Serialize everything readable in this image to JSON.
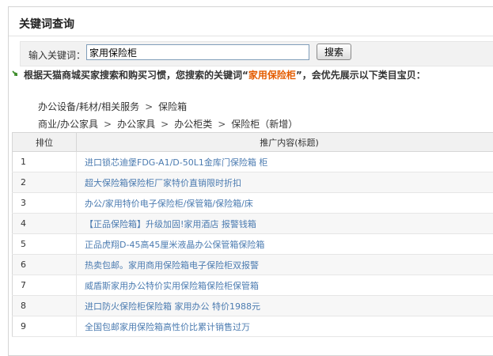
{
  "header": {
    "title": "关键词查询"
  },
  "search": {
    "label": "输入关键词：",
    "value": "家用保险柜",
    "button": "搜索"
  },
  "notice": {
    "prefix": "根据天猫商城买家搜索和购买习惯，您搜索的关键词“",
    "keyword": "家用保险柜",
    "suffix": "”，会优先展示以下类目宝贝："
  },
  "categories": [
    [
      "办公设备/耗材/相关服务",
      "保险箱"
    ],
    [
      "商业/办公家具",
      "办公家具",
      "办公柜类",
      "保险柜（新增）"
    ]
  ],
  "table": {
    "headers": [
      "排位",
      "推广内容(标题)"
    ],
    "rows": [
      {
        "rank": "1",
        "title": "进口锁芯迪堡FDG-A1/D-50L1金库门保险箱 柜"
      },
      {
        "rank": "2",
        "title": "超大保险箱保险柜厂家特价直销限时折扣"
      },
      {
        "rank": "3",
        "title": "办公/家用特价电子保险柜/保管箱/保险箱/床"
      },
      {
        "rank": "4",
        "title": "【正品保险箱】升级加固!家用酒店 报警钱箱"
      },
      {
        "rank": "5",
        "title": "正品虎翔D-45高45厘米液晶办公保管箱保险箱"
      },
      {
        "rank": "6",
        "title": "热卖包邮。家用商用保险箱电子保险柜双报警"
      },
      {
        "rank": "7",
        "title": "威盾斯家用办公特价实用保险箱保险柜保管箱"
      },
      {
        "rank": "8",
        "title": "进口防火保险柜保险箱 家用办公 特价1988元"
      },
      {
        "rank": "9",
        "title": "全国包邮家用保险箱高性价比累计销售过万"
      }
    ]
  },
  "colors": {
    "keyword": "#e45c00",
    "link": "#4b7bb0",
    "notice_icon": "#3d8c2a"
  },
  "icons": {
    "notice": "green-arrow-icon"
  }
}
